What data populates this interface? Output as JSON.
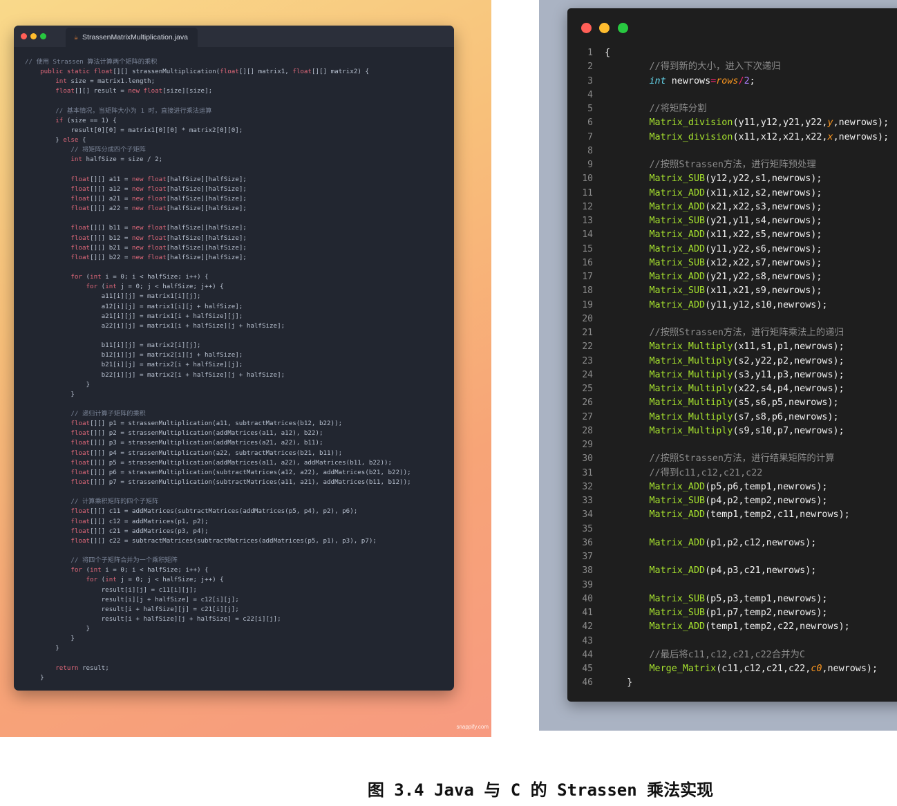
{
  "left_window": {
    "tab_label": "StrassenMatrixMultiplication.java",
    "tab_icon": "java-icon",
    "dot_colors": [
      "#ff5f57",
      "#febc2e",
      "#28c840"
    ],
    "code_lines": [
      "// 使用 Strassen 算法计算两个矩阵的乘积",
      "    public static float[][] strassenMultiplication(float[][] matrix1, float[][] matrix2) {",
      "        int size = matrix1.length;",
      "        float[][] result = new float[size][size];",
      "",
      "        // 基本情况，当矩阵大小为 1 时，直接进行乘法运算",
      "        if (size == 1) {",
      "            result[0][0] = matrix1[0][0] * matrix2[0][0];",
      "        } else {",
      "            // 将矩阵分成四个子矩阵",
      "            int halfSize = size / 2;",
      "",
      "            float[][] a11 = new float[halfSize][halfSize];",
      "            float[][] a12 = new float[halfSize][halfSize];",
      "            float[][] a21 = new float[halfSize][halfSize];",
      "            float[][] a22 = new float[halfSize][halfSize];",
      "",
      "            float[][] b11 = new float[halfSize][halfSize];",
      "            float[][] b12 = new float[halfSize][halfSize];",
      "            float[][] b21 = new float[halfSize][halfSize];",
      "            float[][] b22 = new float[halfSize][halfSize];",
      "",
      "            for (int i = 0; i < halfSize; i++) {",
      "                for (int j = 0; j < halfSize; j++) {",
      "                    a11[i][j] = matrix1[i][j];",
      "                    a12[i][j] = matrix1[i][j + halfSize];",
      "                    a21[i][j] = matrix1[i + halfSize][j];",
      "                    a22[i][j] = matrix1[i + halfSize][j + halfSize];",
      "",
      "                    b11[i][j] = matrix2[i][j];",
      "                    b12[i][j] = matrix2[i][j + halfSize];",
      "                    b21[i][j] = matrix2[i + halfSize][j];",
      "                    b22[i][j] = matrix2[i + halfSize][j + halfSize];",
      "                }",
      "            }",
      "",
      "            // 递归计算子矩阵的乘积",
      "            float[][] p1 = strassenMultiplication(a11, subtractMatrices(b12, b22));",
      "            float[][] p2 = strassenMultiplication(addMatrices(a11, a12), b22);",
      "            float[][] p3 = strassenMultiplication(addMatrices(a21, a22), b11);",
      "            float[][] p4 = strassenMultiplication(a22, subtractMatrices(b21, b11));",
      "            float[][] p5 = strassenMultiplication(addMatrices(a11, a22), addMatrices(b11, b22));",
      "            float[][] p6 = strassenMultiplication(subtractMatrices(a12, a22), addMatrices(b21, b22));",
      "            float[][] p7 = strassenMultiplication(subtractMatrices(a11, a21), addMatrices(b11, b12));",
      "",
      "            // 计算乘积矩阵的四个子矩阵",
      "            float[][] c11 = addMatrices(subtractMatrices(addMatrices(p5, p4), p2), p6);",
      "            float[][] c12 = addMatrices(p1, p2);",
      "            float[][] c21 = addMatrices(p3, p4);",
      "            float[][] c22 = subtractMatrices(subtractMatrices(addMatrices(p5, p1), p3), p7);",
      "",
      "            // 将四个子矩阵合并为一个乘积矩阵",
      "            for (int i = 0; i < halfSize; i++) {",
      "                for (int j = 0; j < halfSize; j++) {",
      "                    result[i][j] = c11[i][j];",
      "                    result[i][j + halfSize] = c12[i][j];",
      "                    result[i + halfSize][j] = c21[i][j];",
      "                    result[i + halfSize][j + halfSize] = c22[i][j];",
      "                }",
      "            }",
      "        }",
      "",
      "        return result;",
      "    }"
    ]
  },
  "watermark": "snappify.com",
  "right_window": {
    "dot_colors": [
      "#ff5f57",
      "#febc2e",
      "#28c840"
    ],
    "line_numbers": [
      "1",
      "2",
      "3",
      "4",
      "5",
      "6",
      "7",
      "8",
      "9",
      "10",
      "11",
      "12",
      "13",
      "14",
      "15",
      "16",
      "17",
      "18",
      "19",
      "20",
      "21",
      "22",
      "23",
      "24",
      "25",
      "26",
      "27",
      "28",
      "29",
      "30",
      "31",
      "32",
      "33",
      "34",
      "35",
      "36",
      "37",
      "38",
      "39",
      "40",
      "41",
      "42",
      "43",
      "44",
      "45",
      "46"
    ],
    "code_lines": [
      "{",
      "        //得到新的大小，进入下次递归",
      "        int newrows=rows/2;",
      "",
      "        //将矩阵分割",
      "        Matrix_division(y11,y12,y21,y22,y,newrows);",
      "        Matrix_division(x11,x12,x21,x22,x,newrows);",
      "",
      "        //按照Strassen方法，进行矩阵预处理",
      "        Matrix_SUB(y12,y22,s1,newrows);",
      "        Matrix_ADD(x11,x12,s2,newrows);",
      "        Matrix_ADD(x21,x22,s3,newrows);",
      "        Matrix_SUB(y21,y11,s4,newrows);",
      "        Matrix_ADD(x11,x22,s5,newrows);",
      "        Matrix_ADD(y11,y22,s6,newrows);",
      "        Matrix_SUB(x12,x22,s7,newrows);",
      "        Matrix_ADD(y21,y22,s8,newrows);",
      "        Matrix_SUB(x11,x21,s9,newrows);",
      "        Matrix_ADD(y11,y12,s10,newrows);",
      "",
      "        //按照Strassen方法，进行矩阵乘法上的递归",
      "        Matrix_Multiply(x11,s1,p1,newrows);",
      "        Matrix_Multiply(s2,y22,p2,newrows);",
      "        Matrix_Multiply(s3,y11,p3,newrows);",
      "        Matrix_Multiply(x22,s4,p4,newrows);",
      "        Matrix_Multiply(s5,s6,p5,newrows);",
      "        Matrix_Multiply(s7,s8,p6,newrows);",
      "        Matrix_Multiply(s9,s10,p7,newrows);",
      "",
      "        //按照Strassen方法，进行结果矩阵的计算",
      "        //得到c11,c12,c21,c22",
      "        Matrix_ADD(p5,p6,temp1,newrows);",
      "        Matrix_SUB(p4,p2,temp2,newrows);",
      "        Matrix_ADD(temp1,temp2,c11,newrows);",
      "",
      "        Matrix_ADD(p1,p2,c12,newrows);",
      "",
      "        Matrix_ADD(p4,p3,c21,newrows);",
      "",
      "        Matrix_SUB(p5,p3,temp1,newrows);",
      "        Matrix_SUB(p1,p7,temp2,newrows);",
      "        Matrix_ADD(temp1,temp2,c22,newrows);",
      "",
      "        //最后将c11,c12,c21,c22合并为C",
      "        Merge_Matrix(c11,c12,c21,c22,c0,newrows);",
      "    }"
    ]
  },
  "caption": "图 3.4 Java 与 C 的 Strassen 乘法实现"
}
